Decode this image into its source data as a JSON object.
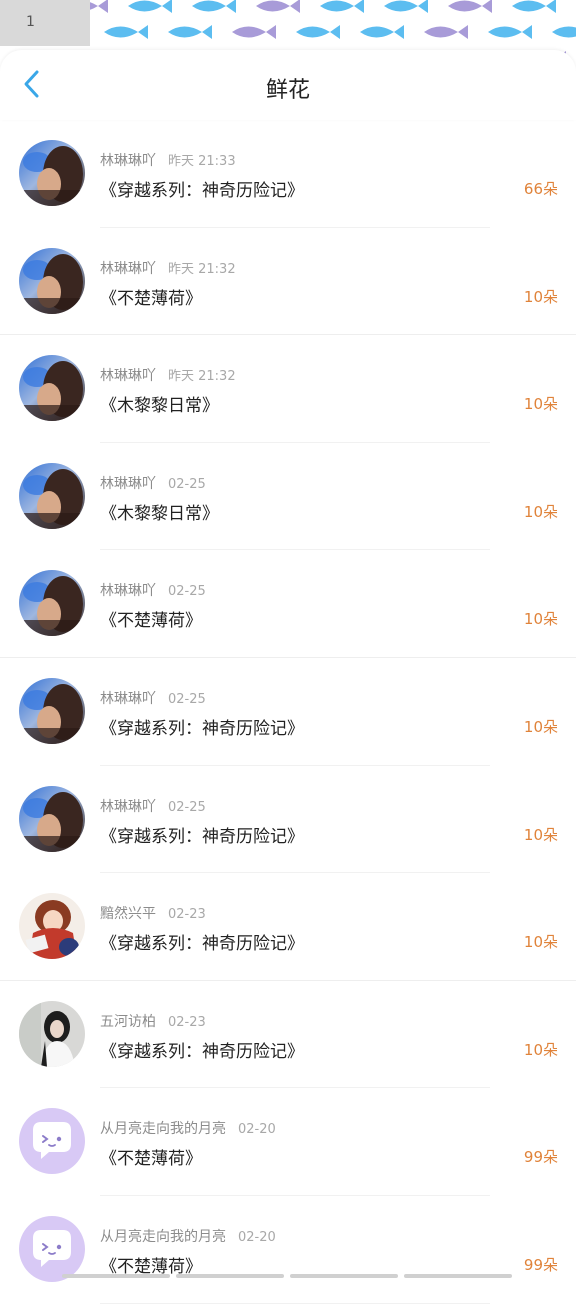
{
  "colors": {
    "accent": "#3aa7e8",
    "count": "#e0833a",
    "fish_blue": "#5cbdf0",
    "fish_purple": "#a89bd8",
    "bubble": "#d8c9f5"
  },
  "statusbar": {
    "indicator": "1"
  },
  "navbar": {
    "back_icon": "chevron-left-icon",
    "title": "鲜花"
  },
  "items": [
    {
      "avatar": "photo-sky",
      "name": "林琳琳吖",
      "time": "昨天 21:33",
      "book": "《穿越系列：神奇历险记》",
      "count": "66朵"
    },
    {
      "avatar": "photo-sky",
      "name": "林琳琳吖",
      "time": "昨天 21:32",
      "book": "《不楚薄荷》",
      "count": "10朵"
    },
    {
      "avatar": "photo-sky",
      "name": "林琳琳吖",
      "time": "昨天 21:32",
      "book": "《木黎黎日常》",
      "count": "10朵"
    },
    {
      "avatar": "photo-sky",
      "name": "林琳琳吖",
      "time": "02-25",
      "book": "《木黎黎日常》",
      "count": "10朵"
    },
    {
      "avatar": "photo-sky",
      "name": "林琳琳吖",
      "time": "02-25",
      "book": "《不楚薄荷》",
      "count": "10朵"
    },
    {
      "avatar": "photo-sky",
      "name": "林琳琳吖",
      "time": "02-25",
      "book": "《穿越系列：神奇历险记》",
      "count": "10朵"
    },
    {
      "avatar": "photo-sky",
      "name": "林琳琳吖",
      "time": "02-25",
      "book": "《穿越系列：神奇历险记》",
      "count": "10朵"
    },
    {
      "avatar": "anime-girl",
      "name": "黯然兴平",
      "time": "02-23",
      "book": "《穿越系列：神奇历险记》",
      "count": "10朵"
    },
    {
      "avatar": "photo-girl",
      "name": "五河访柏",
      "time": "02-23",
      "book": "《穿越系列：神奇历险记》",
      "count": "10朵"
    },
    {
      "avatar": "chat-bubble",
      "name": "从月亮走向我的月亮",
      "time": "02-20",
      "book": "《不楚薄荷》",
      "count": "99朵"
    },
    {
      "avatar": "chat-bubble",
      "name": "从月亮走向我的月亮",
      "time": "02-20",
      "book": "《不楚薄荷》",
      "count": "99朵"
    }
  ]
}
